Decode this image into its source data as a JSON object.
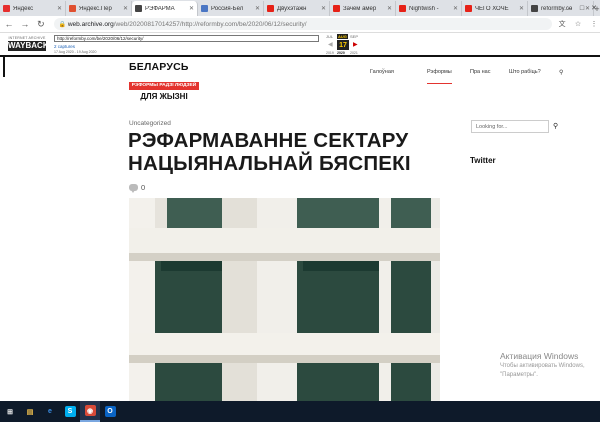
{
  "browser": {
    "tabs": [
      {
        "label": "Яндекс",
        "color": "#e62e2e",
        "active": false
      },
      {
        "label": "Яндекс.Пер",
        "color": "#e05030",
        "active": false
      },
      {
        "label": "РЭФАРМА",
        "color": "#444444",
        "active": true
      },
      {
        "label": "Россия-Бел",
        "color": "#4a76c4",
        "active": false
      },
      {
        "label": "Двухэтажн",
        "color": "#e62117",
        "active": false
      },
      {
        "label": "Зачем амер",
        "color": "#e62117",
        "active": false
      },
      {
        "label": "Nightwish -",
        "color": "#e62117",
        "active": false
      },
      {
        "label": "ЧЕГО ХОЧЕ",
        "color": "#e62117",
        "active": false
      },
      {
        "label": "reformby.co",
        "color": "#444444",
        "active": false
      }
    ],
    "new_tab_glyph": "+",
    "window_controls": [
      "–",
      "□",
      "✕"
    ],
    "address": {
      "host": "web.archive.org",
      "path": "/web/20200817014257/http://reformby.com/be/2020/06/12/security/"
    }
  },
  "wayback": {
    "logo_top": "INTERNET ARCHIVE",
    "logo_mark": "WAYBACK",
    "url_value": "http://reformby.com/be/2020/06/12/security/",
    "captures": "2 captures",
    "range": "17 Aug 2020 - 19 Aug 2020",
    "months": {
      "prev": "JUL",
      "cur": "AUG",
      "next": "SEP"
    },
    "day": "17",
    "years": {
      "prev": "2019",
      "cur": "2020",
      "next": "2021"
    }
  },
  "site": {
    "logo": {
      "line1": "БЕЛАРУСЬ",
      "band": "РЭФОРМЫ РАДЗІ ЛЮДЗЕЙ",
      "line3": "ДЛЯ ЖЫЗНІ"
    },
    "nav": [
      {
        "label": "Галоўная"
      },
      {
        "label": "Рэформы"
      },
      {
        "label": "Пра нас"
      },
      {
        "label": "Што рабіць?"
      }
    ],
    "search_glyph": "⚲"
  },
  "article": {
    "category": "Uncategorized",
    "title": "РЭФАРМАВАННЕ СЕКТАРУ НАЦЫЯНАЛЬНАЙ БЯСПЕКІ",
    "comments_count": "0"
  },
  "sidebar": {
    "search_placeholder": "Looking for...",
    "twitter_heading": "Twitter"
  },
  "watermark": {
    "line1": "Активация Windows",
    "line2": "Чтобы активировать Windows,",
    "line3": "\"Параметры\"."
  },
  "taskbar": {
    "items": [
      {
        "icon": "windows-start-icon",
        "glyph": "⊞",
        "color": "#ffffff",
        "bg": "transparent"
      },
      {
        "icon": "file-explorer-icon",
        "glyph": "▤",
        "color": "#f2c14e",
        "bg": "transparent"
      },
      {
        "icon": "internet-explorer-icon",
        "glyph": "e",
        "color": "#3a8ee6",
        "bg": "transparent"
      },
      {
        "icon": "skype-icon",
        "glyph": "S",
        "color": "#ffffff",
        "bg": "#00aff0"
      },
      {
        "icon": "chrome-icon",
        "glyph": "◉",
        "color": "#ffffff",
        "bg": "#d94a38"
      },
      {
        "icon": "outlook-icon",
        "glyph": "O",
        "color": "#ffffff",
        "bg": "#0a64c4"
      }
    ]
  }
}
